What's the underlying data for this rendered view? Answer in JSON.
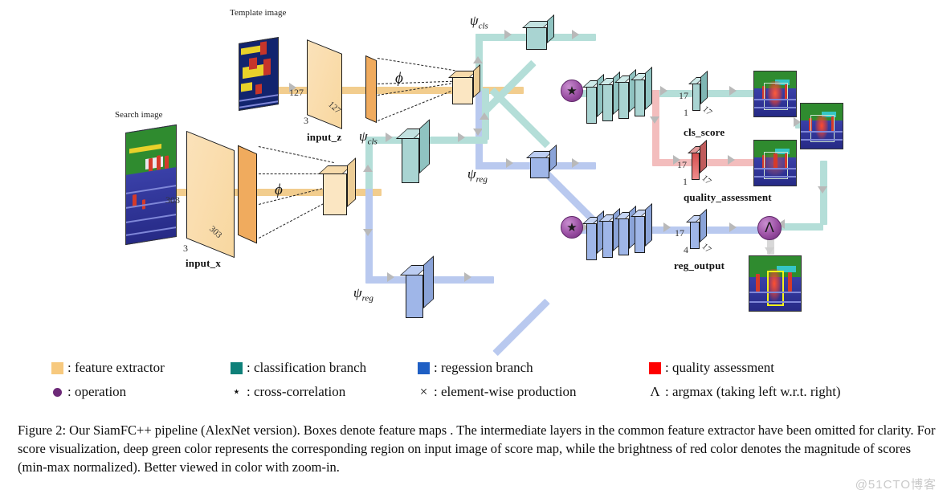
{
  "figure": {
    "labels": {
      "template_image": "Template image",
      "search_image": "Search image",
      "input_z": "input_z",
      "input_x": "input_x",
      "cls_score": "cls_score",
      "quality_assessment": "quality_assessment",
      "reg_output": "reg_output",
      "phi": "ϕ",
      "psi_cls": "ψ",
      "psi_cls_sub": "cls",
      "psi_reg": "ψ",
      "psi_reg_sub": "reg"
    },
    "dims": {
      "z_h": "127",
      "z_w": "127",
      "z_c": "3",
      "x_h": "303",
      "x_w": "303",
      "x_c": "3",
      "cls_h": "17",
      "cls_w": "17",
      "cls_c": "1",
      "qa_h": "17",
      "qa_w": "17",
      "qa_c": "1",
      "reg_h": "17",
      "reg_w": "17",
      "reg_c": "4"
    },
    "nodes": {
      "xcorr_cls": "★",
      "xcorr_reg": "★",
      "elementwise": "✕",
      "argmax": "Λ"
    }
  },
  "legend": {
    "row1": [
      {
        "type": "swatch",
        "color": "#f7c97e",
        "text": ": feature extractor"
      },
      {
        "type": "swatch",
        "color": "#0e8079",
        "text": ": classification branch"
      },
      {
        "type": "swatch",
        "color": "#1f5fc4",
        "text": ": regession branch"
      },
      {
        "type": "swatch",
        "color": "#fe0000",
        "text": ": quality assessment"
      }
    ],
    "row2": [
      {
        "type": "dot",
        "color": "#6d2a78",
        "text": ": operation"
      },
      {
        "type": "sym",
        "glyph": "⋆",
        "text": ": cross-correlation"
      },
      {
        "type": "sym",
        "glyph": "×",
        "text": ": element-wise production"
      },
      {
        "type": "sym",
        "glyph": "Λ",
        "text": ": argmax (taking left w.r.t. right)"
      }
    ],
    "row2_italics": {
      "left": "left",
      "right": "right"
    }
  },
  "caption": {
    "text": "Figure 2: Our SiamFC++ pipeline (AlexNet version). Boxes denote feature maps . The intermediate layers in the common feature extractor have been omitted for clarity. For score visualization, deep green color represents the corresponding region on input image of score map, while the brightness of red color denotes the magnitude of scores (min-max normalized). Better viewed in color with zoom-in."
  },
  "watermark": {
    "text": "@51CTO博客"
  },
  "colors": {
    "feature_extractor": "#f7c97e",
    "classification_branch": "#0e8079",
    "regression_branch": "#1f5fc4",
    "quality_assessment": "#fe0000",
    "operation": "#6d2a78",
    "pipe_orange": "#f2cd8e",
    "pipe_teal": "#b4ded8",
    "pipe_blue": "#b9c9ef",
    "pipe_red": "#f3bdbd"
  }
}
